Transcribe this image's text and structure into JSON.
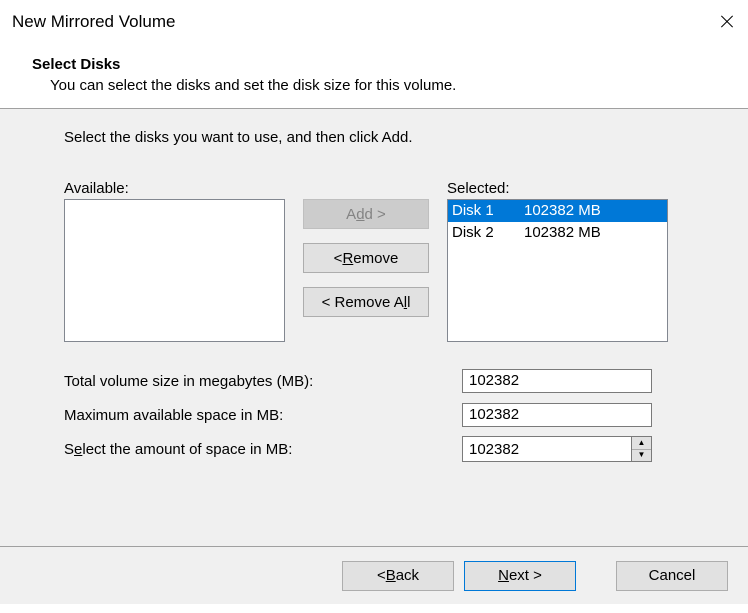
{
  "window": {
    "title": "New Mirrored Volume"
  },
  "header": {
    "title": "Select Disks",
    "subtitle": "You can select the disks and set the disk size for this volume."
  },
  "instruction": "Select the disks you want to use, and then click Add.",
  "labels": {
    "available": "Available:",
    "selected": "Selected:"
  },
  "availableList": [],
  "selectedList": [
    {
      "name": "Disk 1",
      "size": "102382 MB",
      "selected": true
    },
    {
      "name": "Disk 2",
      "size": "102382 MB",
      "selected": false
    }
  ],
  "buttons": {
    "add_pre": "A",
    "add_m": "d",
    "add_post": "d >",
    "remove_pre": "< ",
    "remove_m": "R",
    "remove_post": "emove",
    "removeall_pre": "< Remove A",
    "removeall_m": "l",
    "removeall_post": "l"
  },
  "fields": {
    "total_label": "Total volume size in megabytes (MB):",
    "total_value": "102382",
    "max_label": "Maximum available space in MB:",
    "max_value": "102382",
    "space_pre": "S",
    "space_m": "e",
    "space_post": "lect the amount of space in MB:",
    "space_value": "102382"
  },
  "footer": {
    "back_pre": "< ",
    "back_m": "B",
    "back_post": "ack",
    "next_pre": "",
    "next_m": "N",
    "next_post": "ext >",
    "cancel": "Cancel"
  }
}
